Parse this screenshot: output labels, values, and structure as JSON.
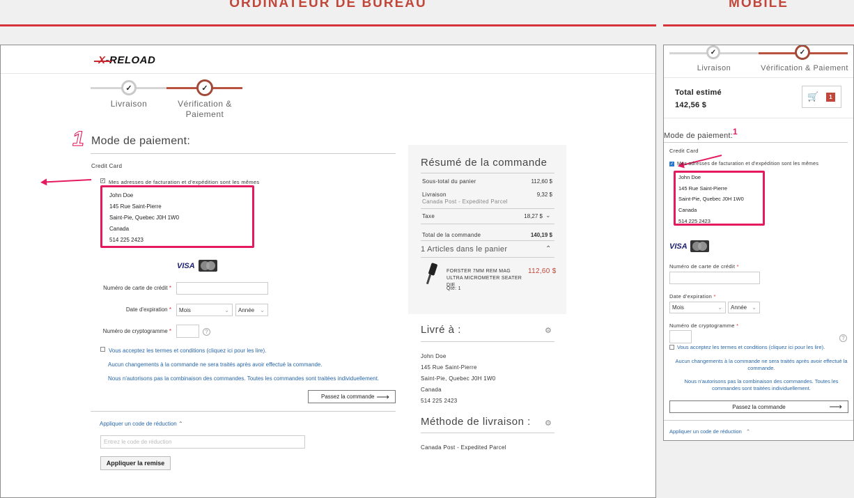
{
  "headers": {
    "desktop": "ORDINATEUR DE BUREAU",
    "mobile": "MOBILE"
  },
  "brand": {
    "logo_text": "-RELOAD",
    "logo_x": "X"
  },
  "steps": {
    "step1": "Livraison",
    "step2_desktop": "Vérification & Paiement",
    "step2_mobile": "Vérification & Paiement"
  },
  "payment": {
    "marker": "1",
    "title": "Mode de paiement:",
    "method": "Credit Card",
    "same_address_label": "Mes adresses de facturation et d'expédition sont les mêmes",
    "address": [
      "John Doe",
      "145 Rue Saint-Pierre",
      "Saint-Pie, Quebec J0H 1W0",
      "Canada",
      "514 225 2423"
    ],
    "cards": {
      "visa": "VISA",
      "mastercard": "MasterCard"
    },
    "card_number_label": "Numéro de carte de crédit",
    "expiry_label": "Date d'expiration",
    "month_placeholder": "Mois",
    "year_placeholder": "Année",
    "cvv_label": "Numéro de cryptogramme",
    "terms": "Vous acceptez les termes et conditions (cliquez ici pour les lire).",
    "notice1": "Aucun changements à la commande ne sera traités après avoir effectué la commande.",
    "notice2": "Nous n'autorisons pas la combinaison des commandes. Toutes les commandes sont traitées individuellement.",
    "place_order": "Passez la commande",
    "discount_toggle": "Appliquer un code de réduction",
    "discount_placeholder": "Entrez le code de réduction",
    "apply_discount": "Appliquer la remise"
  },
  "summary": {
    "title": "Résumé de la commande",
    "subtotal_label": "Sous-total du panier",
    "subtotal": "112,60 $",
    "shipping_label": "Livraison",
    "shipping_method": "Canada Post - Expedited Parcel",
    "shipping": "9,32 $",
    "tax_label": "Taxe",
    "tax": "18,27 $",
    "total_label": "Total de la commande",
    "total": "140,19 $",
    "items_count": "1 Articles dans le panier",
    "item": {
      "name": "FORSTER 7MM REM MAG ULTRA MICROMETER SEATER DIE",
      "price": "112,60 $",
      "qty": "Qté: 1"
    }
  },
  "ship_to": {
    "title": "Livré à :",
    "lines": [
      "John Doe",
      "145 Rue Saint-Pierre",
      "Saint-Pie, Quebec J0H 1W0",
      "Canada",
      "514 225 2423"
    ]
  },
  "ship_method": {
    "title": "Méthode de livraison :",
    "value": "Canada Post - Expedited Parcel"
  },
  "mobile": {
    "total_label": "Total estimé",
    "total": "142,56 $",
    "cart_count": "1",
    "payment_title": "Mode de paiement:",
    "marker": "1",
    "method": "Credit Card",
    "card_number_label": "Numéro de carte de crédit",
    "expiry_label": "Date d'expiration",
    "cvv_label": "Numéro de cryptogramme",
    "notice2": "Nous n'autorisons pas la combinaison des commandes. Toutes les commandes sont traitées individuellement."
  },
  "colors": {
    "accent": "#c0473a",
    "highlight": "#e5195e",
    "link": "#2866a8"
  }
}
